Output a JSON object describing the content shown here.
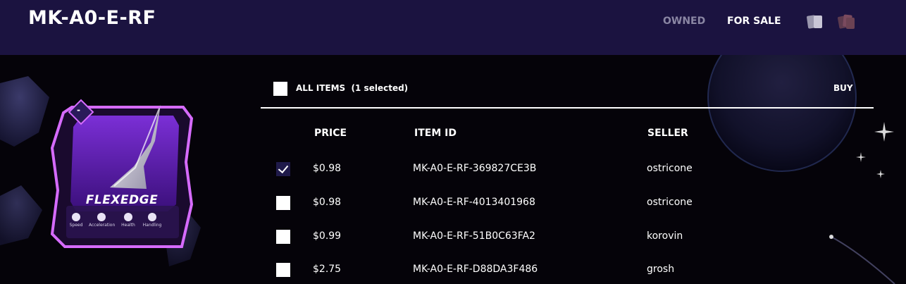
{
  "header": {
    "title": "MK-A0-E-RF",
    "nav": [
      {
        "label": "OWNED",
        "active": false
      },
      {
        "label": "FOR SALE",
        "active": true
      }
    ],
    "view_icons": [
      "card-grid-view-icon",
      "card-stack-view-icon"
    ]
  },
  "card": {
    "badge": "-",
    "name": "FLEXEDGE",
    "stats": [
      "Speed",
      "Acceleration",
      "Health",
      "Handling"
    ]
  },
  "listing": {
    "select_all_label": "ALL ITEMS  (1 selected)",
    "buy_label": "BUY",
    "columns": {
      "price": "PRICE",
      "item_id": "ITEM ID",
      "seller": "SELLER"
    },
    "rows": [
      {
        "checked": true,
        "price": "$0.98",
        "item_id": "MK-A0-E-RF-369827CE3B",
        "seller": "ostricone"
      },
      {
        "checked": false,
        "price": "$0.98",
        "item_id": "MK-A0-E-RF-4013401968",
        "seller": "ostricone"
      },
      {
        "checked": false,
        "price": "$0.99",
        "item_id": "MK-A0-E-RF-51B0C63FA2",
        "seller": "korovin"
      },
      {
        "checked": false,
        "price": "$2.75",
        "item_id": "MK-A0-E-RF-D88DA3F486",
        "seller": "grosh"
      }
    ]
  },
  "colors": {
    "header_bg": "#1b1340",
    "page_bg": "#050309",
    "card_glow": "#d66bff",
    "card_inner": "#6a1fb5"
  }
}
